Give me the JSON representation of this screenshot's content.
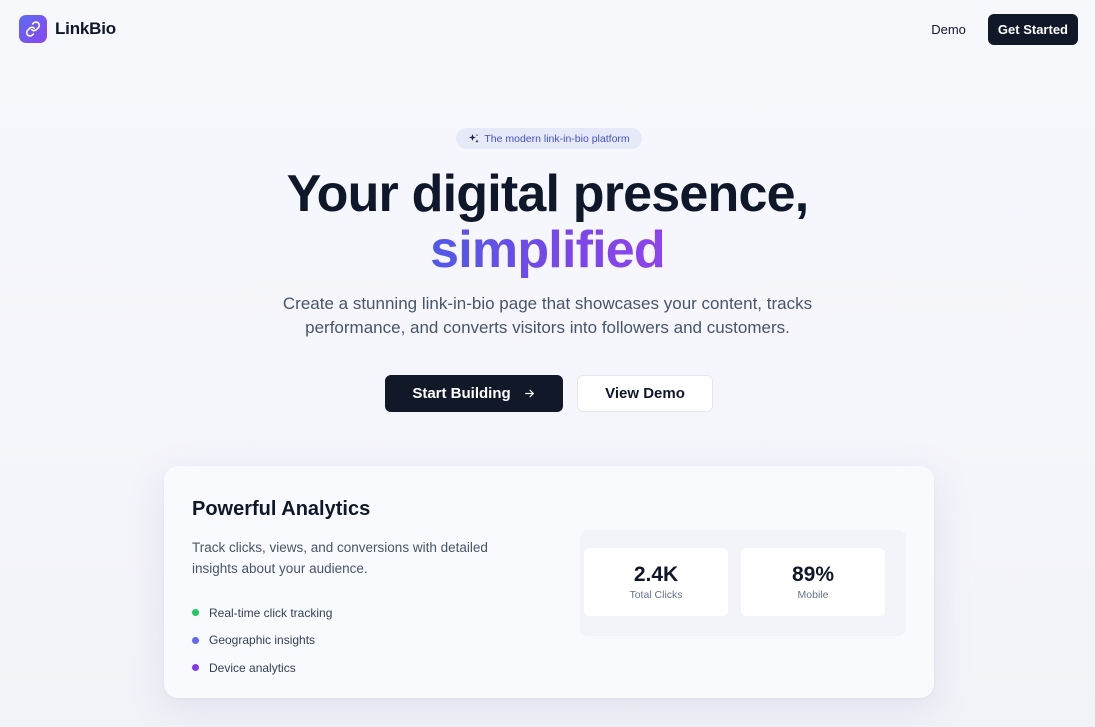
{
  "brand": {
    "name": "LinkBio",
    "logo_icon": "link-icon",
    "gradient": [
      "#5b6cf2",
      "#8b45f0"
    ]
  },
  "nav": {
    "demo_label": "Demo",
    "cta_label": "Get Started"
  },
  "hero": {
    "badge_icon": "sparkles-icon",
    "badge_text": "The modern link-in-bio platform",
    "title_line1": "Your digital presence,",
    "title_line2": "simplified",
    "subtitle": "Create a stunning link-in-bio page that showcases your content, tracks performance, and converts visitors into followers and customers.",
    "primary_button": "Start Building",
    "primary_button_icon": "arrow-right-icon",
    "secondary_button": "View Demo"
  },
  "analytics": {
    "title": "Powerful Analytics",
    "description": "Track clicks, views, and conversions with detailed insights about your audience.",
    "features": [
      {
        "label": "Real-time click tracking",
        "color": "#22c55e"
      },
      {
        "label": "Geographic insights",
        "color": "#6366f1"
      },
      {
        "label": "Device analytics",
        "color": "#7c3aed"
      }
    ],
    "stats": [
      {
        "value": "2.4K",
        "label": "Total Clicks"
      },
      {
        "value": "89%",
        "label": "Mobile"
      }
    ]
  },
  "colors": {
    "accent": "#4f5ae8",
    "dark": "#111827"
  }
}
